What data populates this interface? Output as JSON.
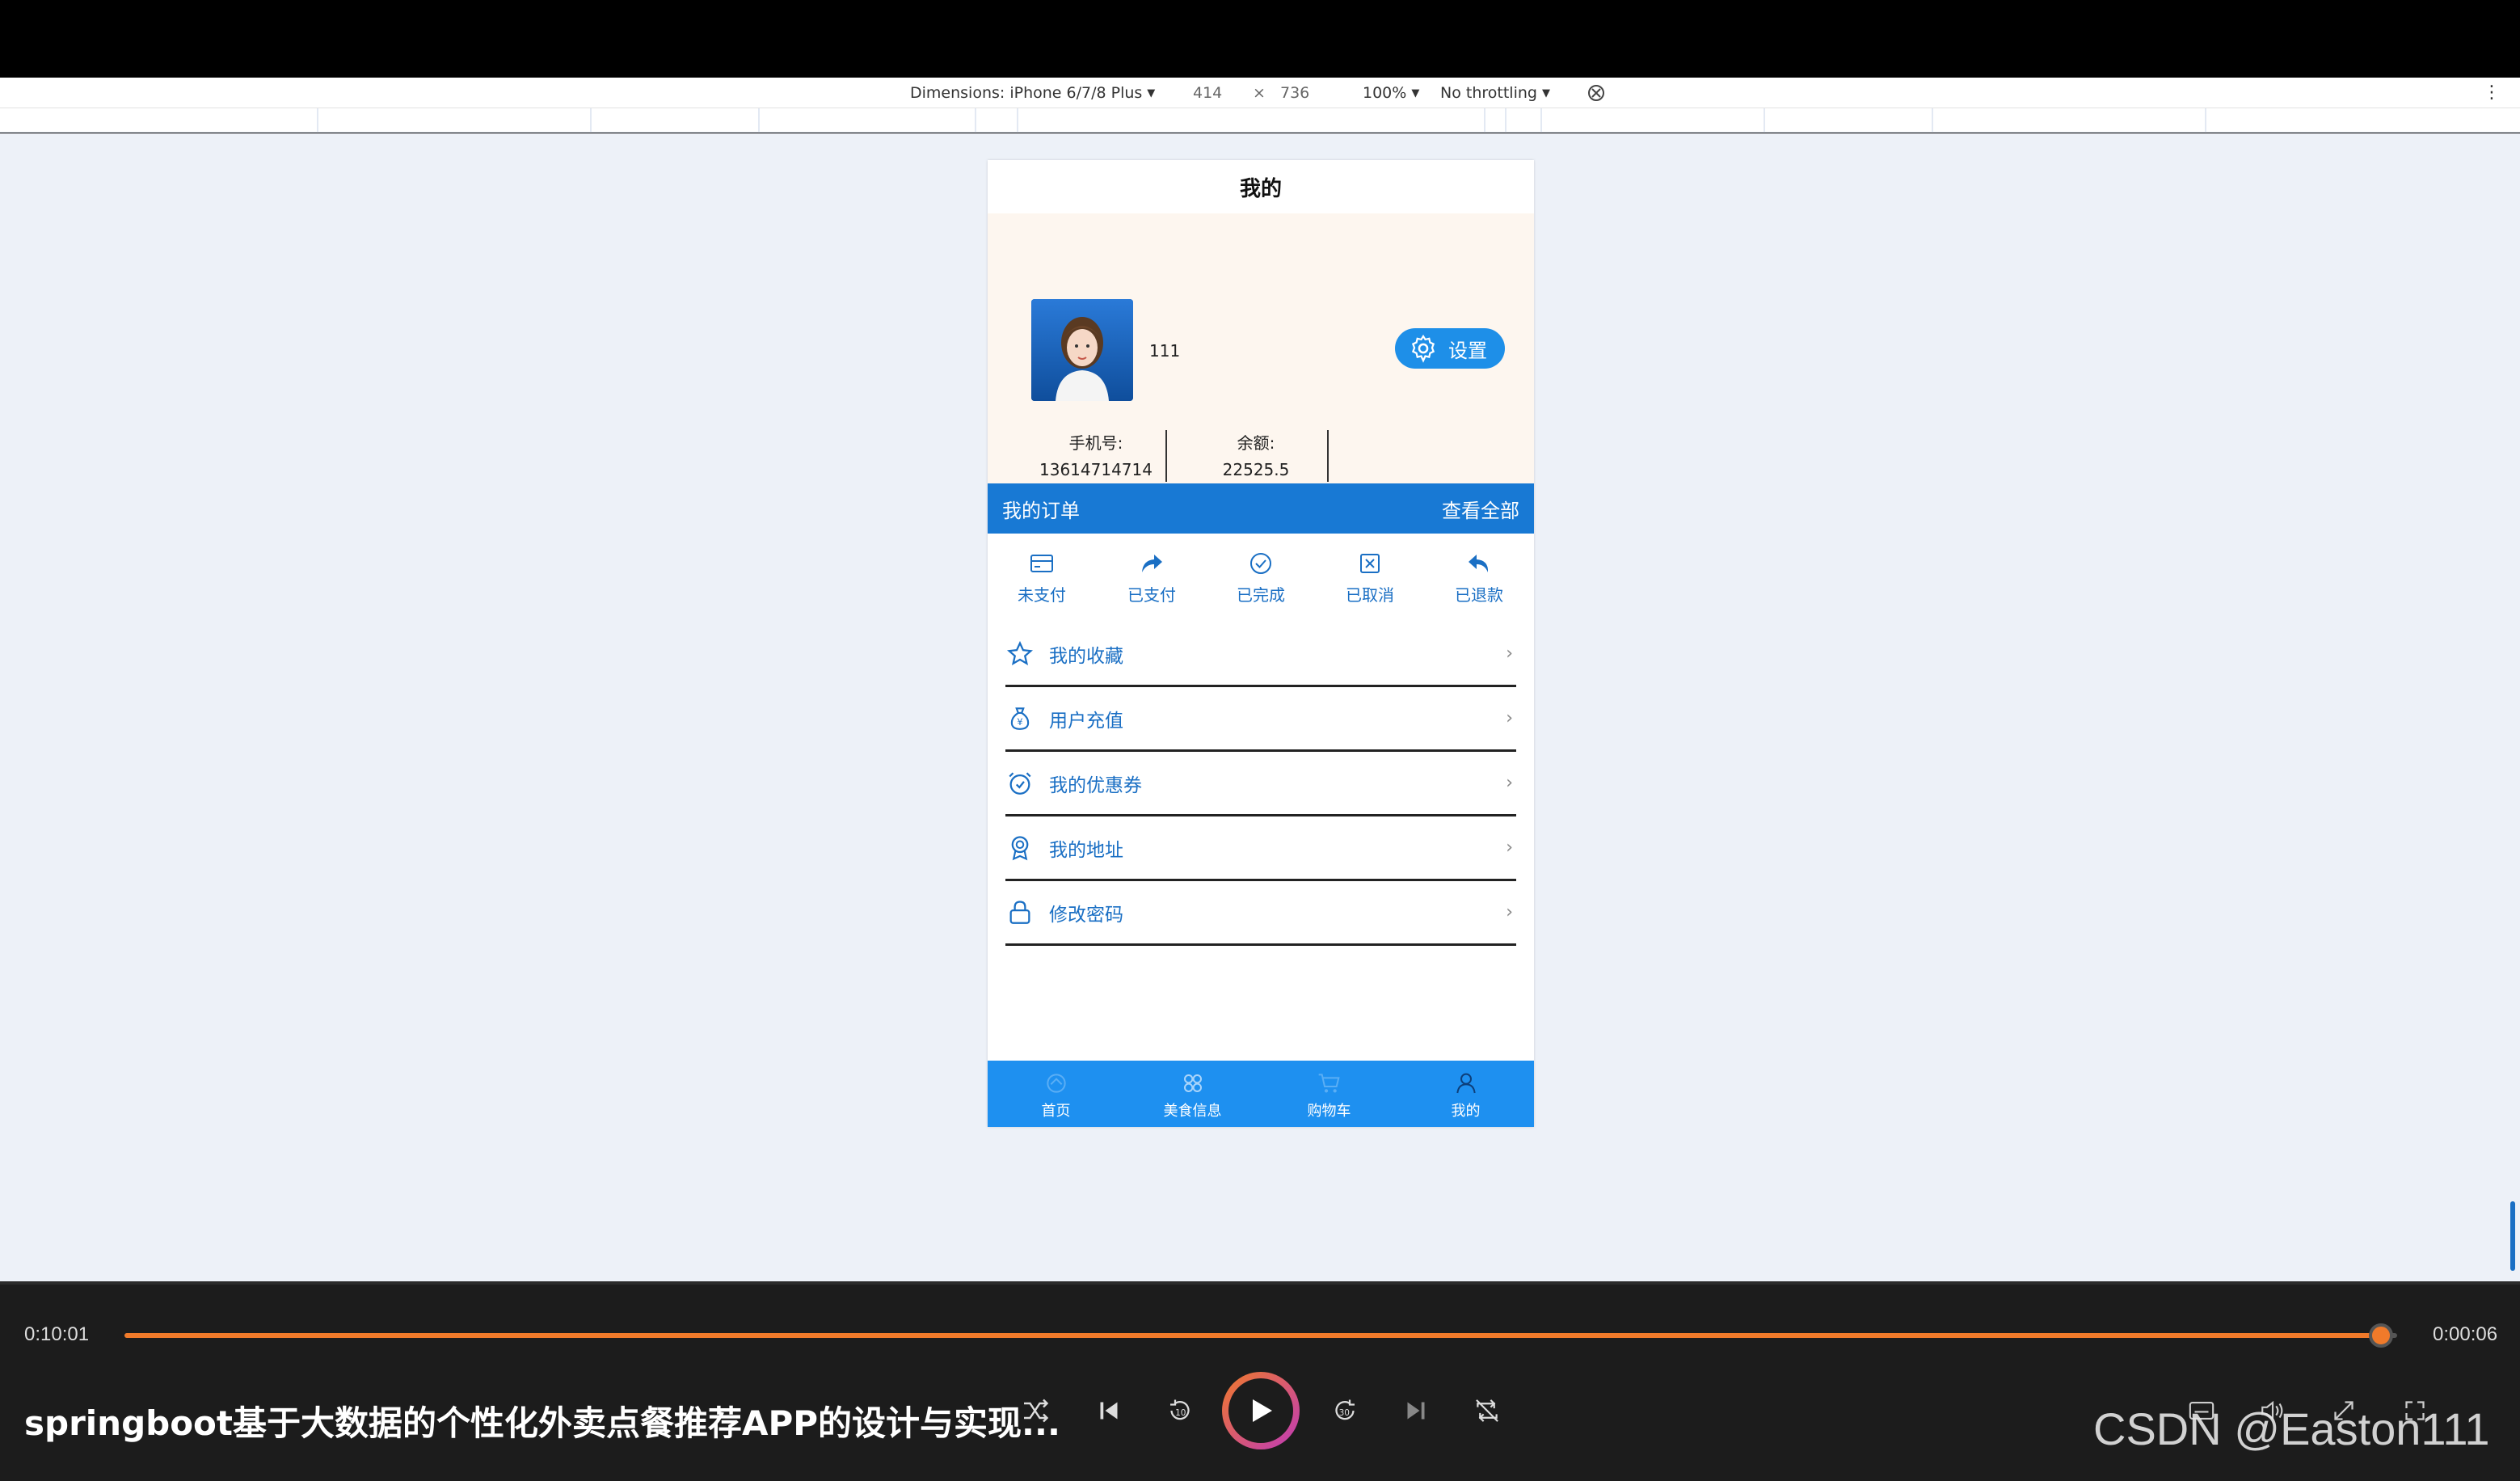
{
  "devtools": {
    "dimensions_label": "Dimensions: iPhone 6/7/8 Plus",
    "width": "414",
    "times": "×",
    "height": "736",
    "zoom": "100%",
    "throttle": "No throttling"
  },
  "app": {
    "header_title": "我的",
    "user": {
      "name": "111"
    },
    "settings_label": "设置",
    "phone_label": "手机号:",
    "phone_value": "13614714714",
    "balance_label": "余额:",
    "balance_value": "22525.5",
    "orders": {
      "title": "我的订单",
      "view_all": "查看全部",
      "items": [
        {
          "label": "未支付",
          "icon": "card-icon"
        },
        {
          "label": "已支付",
          "icon": "share-arrow-icon"
        },
        {
          "label": "已完成",
          "icon": "check-circle-icon"
        },
        {
          "label": "已取消",
          "icon": "x-square-icon"
        },
        {
          "label": "已退款",
          "icon": "return-arrow-icon"
        }
      ]
    },
    "menu": [
      {
        "label": "我的收藏",
        "icon": "star-icon"
      },
      {
        "label": "用户充值",
        "icon": "money-bag-icon"
      },
      {
        "label": "我的优惠券",
        "icon": "alarm-clock-icon"
      },
      {
        "label": "我的地址",
        "icon": "badge-icon"
      },
      {
        "label": "修改密码",
        "icon": "lock-icon"
      }
    ],
    "tabs": [
      {
        "label": "首页",
        "icon": "home-icon"
      },
      {
        "label": "美食信息",
        "icon": "grid-icon"
      },
      {
        "label": "购物车",
        "icon": "cart-icon"
      },
      {
        "label": "我的",
        "icon": "user-icon"
      }
    ],
    "accent": "#1e90f0"
  },
  "player": {
    "elapsed": "0:10:01",
    "remaining": "0:00:06",
    "progress": 0.993,
    "title": "springboot基于大数据的个性化外卖点餐推荐APP的设计与实现...",
    "watermark": "CSDN @Easton111",
    "accent": "#f07a2a"
  }
}
